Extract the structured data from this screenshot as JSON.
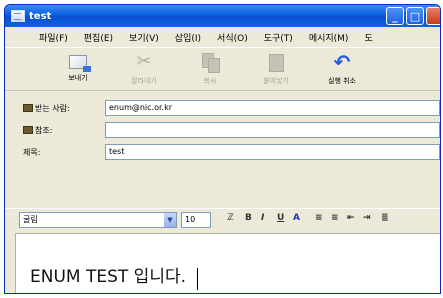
{
  "window": {
    "title": "test"
  },
  "menu": [
    "파일(F)",
    "편집(E)",
    "보기(V)",
    "삽입(I)",
    "서식(O)",
    "도구(T)",
    "메시지(M)",
    "도"
  ],
  "toolbar": {
    "send": "보내기",
    "cut": "잘라내기",
    "copy": "복사",
    "paste": "붙여넣기",
    "undo": "실행 취소"
  },
  "headers": {
    "to_label": "받는 사람:",
    "to_value": "enum@nic.or.kr",
    "cc_label": "참조:",
    "cc_value": "",
    "subject_label": "제목:",
    "subject_value": "test"
  },
  "format": {
    "font": "굴림",
    "size": "10"
  },
  "body": {
    "text": "ENUM TEST 입니다."
  }
}
